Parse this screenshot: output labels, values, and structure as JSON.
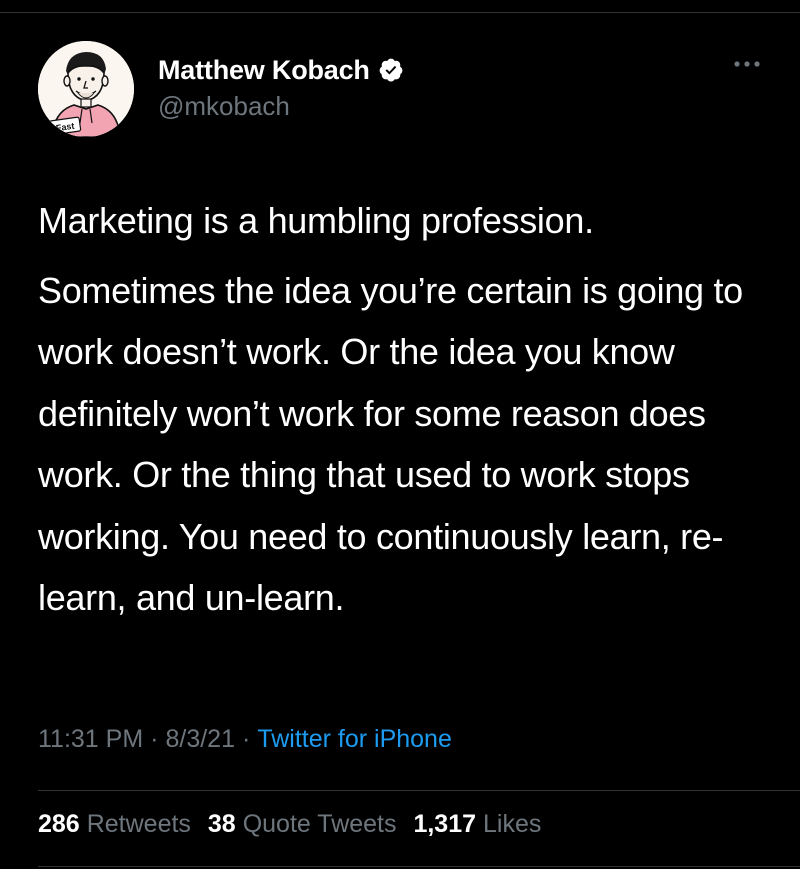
{
  "author": {
    "display_name": "Matthew Kobach",
    "handle": "@mkobach",
    "verified": true,
    "avatar_caption": "Fast"
  },
  "tweet": {
    "paragraphs": [
      "Marketing is a humbling profession.",
      "Sometimes the idea you’re certain is going to work doesn’t work. Or the idea you know definitely won’t work for some reason does work. Or the thing that used to work stops working. You need to continuously learn, re-learn, and un-learn."
    ]
  },
  "meta": {
    "time": "11:31 PM",
    "date": "8/3/21",
    "separator": "·",
    "source": "Twitter for iPhone"
  },
  "stats": {
    "retweets": {
      "count": "286",
      "label": "Retweets"
    },
    "quote_tweets": {
      "count": "38",
      "label": "Quote Tweets"
    },
    "likes": {
      "count": "1,317",
      "label": "Likes"
    }
  },
  "icons": {
    "verified": "verified-badge-icon",
    "more": "more-options-icon"
  },
  "colors": {
    "background": "#000000",
    "text": "#ffffff",
    "secondary": "#6e767d",
    "link": "#1d9bf0",
    "divider": "#2f3336"
  }
}
